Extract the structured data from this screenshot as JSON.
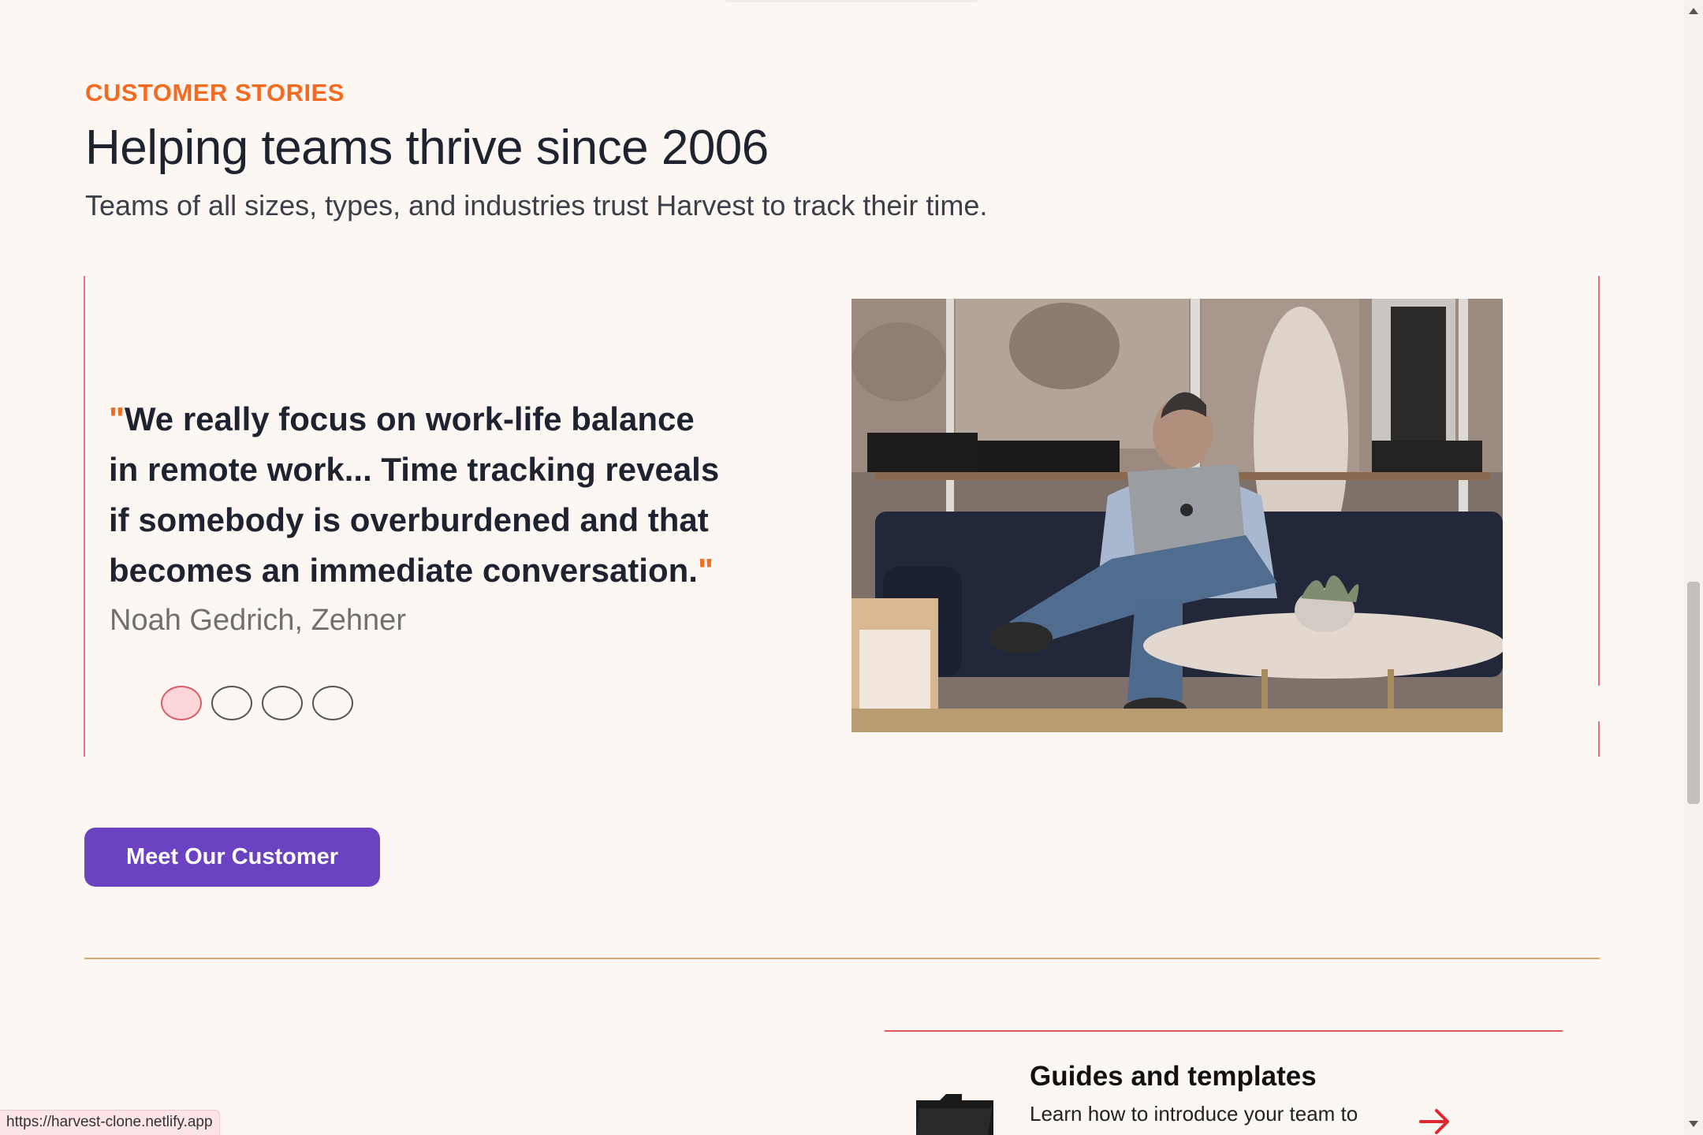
{
  "section": {
    "eyebrow": "CUSTOMER STORIES",
    "headline": "Helping teams thrive since 2006",
    "subhead": "Teams of all sizes, types, and industries trust Harvest to track their time."
  },
  "story": {
    "quote_open": "\"",
    "quote_text": "We really focus on work-life balance in remote work... Time tracking reveals if somebody is overburdened and that becomes an immediate conversation.",
    "quote_close": "\"",
    "author": "Noah Gedrich, Zehner",
    "slides_count": 4,
    "active_slide": 1
  },
  "cta": {
    "label": "Meet Our Customer"
  },
  "guides": {
    "title": "Guides and templates",
    "description": "Learn how to introduce your team to"
  },
  "status_bar": {
    "url": "https://harvest-clone.netlify.app"
  },
  "colors": {
    "background": "#fdf7f3",
    "accent_orange": "#f36b21",
    "button_purple": "#6a42c2",
    "frame_red": "#e8707e",
    "divider_tan": "#d9a66e"
  },
  "icons": {
    "folder": "folder-icon",
    "arrow": "arrow-right-icon"
  }
}
